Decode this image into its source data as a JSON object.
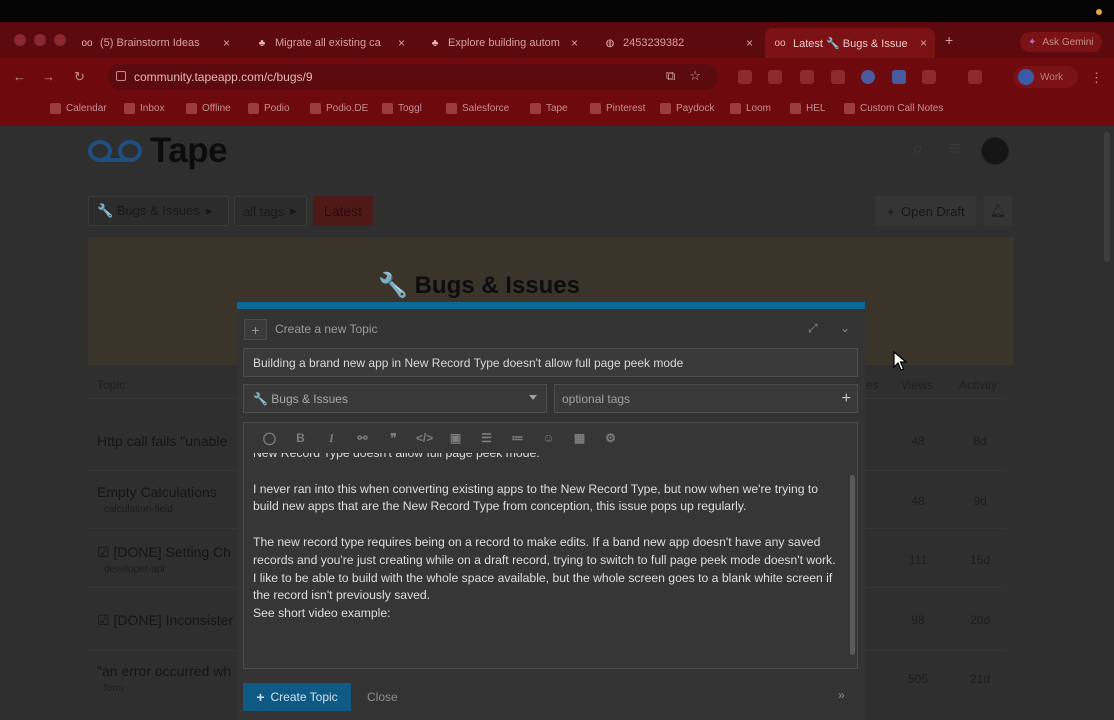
{
  "browser": {
    "tabs": [
      {
        "label": "(5) Brainstorm Ideas",
        "icon": "tape-icon"
      },
      {
        "label": "Migrate all existing ca",
        "icon": "leaf-icon"
      },
      {
        "label": "Explore building autom",
        "icon": "leaf-icon"
      },
      {
        "label": "2453239382",
        "icon": "globe-icon"
      },
      {
        "label": "Latest 🔧 Bugs & Issue",
        "icon": "tape-icon"
      }
    ],
    "gemini_label": "Ask Gemini",
    "url": "community.tapeapp.com/c/bugs/9",
    "profile_label": "Work",
    "bookmarks": [
      "Calendar",
      "Inbox",
      "Offline",
      "Podio",
      "Podio.DE",
      "Toggl",
      "Salesforce",
      "Tape",
      "Pinterest",
      "Paydock",
      "Loom",
      "HEL",
      "Custom Call Notes"
    ]
  },
  "site": {
    "logo_text": "Tape",
    "breadcrumbs": {
      "category": "🔧 Bugs & Issues",
      "tags": "all tags",
      "latest": "Latest"
    },
    "open_draft": "Open Draft",
    "banner_title": "🔧 Bugs & Issues",
    "table_headers": {
      "topic": "Topic",
      "replies": "es",
      "views": "Views",
      "activity": "Activity"
    },
    "topics": [
      {
        "title": "Http call fails \"unable",
        "tag": "",
        "views": "48",
        "activity": "8d"
      },
      {
        "title": "Empty Calculations",
        "tag": "calculation-field",
        "views": "48",
        "activity": "9d"
      },
      {
        "title": "☑ [DONE] Setting Ch",
        "tag": "developer-api",
        "views": "111",
        "activity": "15d"
      },
      {
        "title": "☑ [DONE] Inconsister",
        "tag": "",
        "views": "98",
        "activity": "20d"
      },
      {
        "title": "\"an error occurred wh",
        "tag": "form",
        "views": "505",
        "activity": "21d"
      }
    ]
  },
  "composer": {
    "header_label": "Create a new Topic",
    "title_value": "Building a brand new app in New Record Type doesn't allow full page peek mode",
    "category_value": "🔧 Bugs & Issues",
    "tags_placeholder": "optional tags",
    "body_lines": {
      "p0_cut": "New Record Type doesn't allow full page peek mode.",
      "p1": "I never ran into this when converting existing apps to the New Record Type, but now when we're trying to build new apps that are the New Record Type from conception, this issue pops up regularly.",
      "p2": "The new record type requires being on a record to make edits. If a band new app doesn't have any saved records and you're just creating while on a draft record, trying to switch to full page peek mode doesn't work.",
      "p3": "I like to be able to build with the whole space available, but the whole screen goes to a blank white screen if the record isn't previously saved.",
      "p4": "See short video example:"
    },
    "create_button": "Create Topic",
    "close_label": "Close",
    "collapse_glyph": "»"
  },
  "colors": {
    "chrome_tint": "#6e0a0e",
    "composer_accent": "#0a6a95",
    "latest_button": "#4e1a18",
    "create_button": "#0e5a85"
  }
}
